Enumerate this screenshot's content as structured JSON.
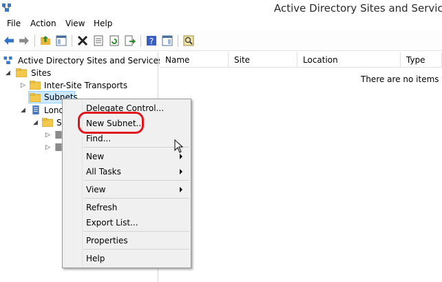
{
  "window": {
    "title": "Active Directory Sites and Services"
  },
  "menu": [
    "File",
    "Action",
    "View",
    "Help"
  ],
  "tree": {
    "root": "Active Directory Sites and Services [LO",
    "sites": "Sites",
    "inter_site": "Inter-Site Transports",
    "subnets": "Subnets",
    "london": "Lond",
    "servers_partial": "S"
  },
  "list": {
    "columns": [
      "Name",
      "Site",
      "Location",
      "Type"
    ],
    "empty_message": "There are no items to s"
  },
  "context_menu": {
    "items": {
      "delegate": "Delegate Control...",
      "new_subnet": "New Subnet...",
      "find": "Find...",
      "new": "New",
      "all_tasks": "All Tasks",
      "view": "View",
      "refresh": "Refresh",
      "export": "Export List...",
      "properties": "Properties",
      "help": "Help"
    }
  },
  "colors": {
    "highlight_ring": "#e0121b",
    "selection": "#cce8ff",
    "folder": "#f2c94c"
  },
  "icons": [
    "ad-sites-app-icon",
    "back-arrow-icon",
    "forward-arrow-icon",
    "up-folder-icon",
    "show-tree-icon",
    "delete-icon",
    "properties-icon",
    "refresh-icon",
    "export-icon",
    "help-icon",
    "action-pane-icon",
    "filter-icon",
    "folder-icon",
    "server-icon",
    "mouse-cursor-icon"
  ]
}
